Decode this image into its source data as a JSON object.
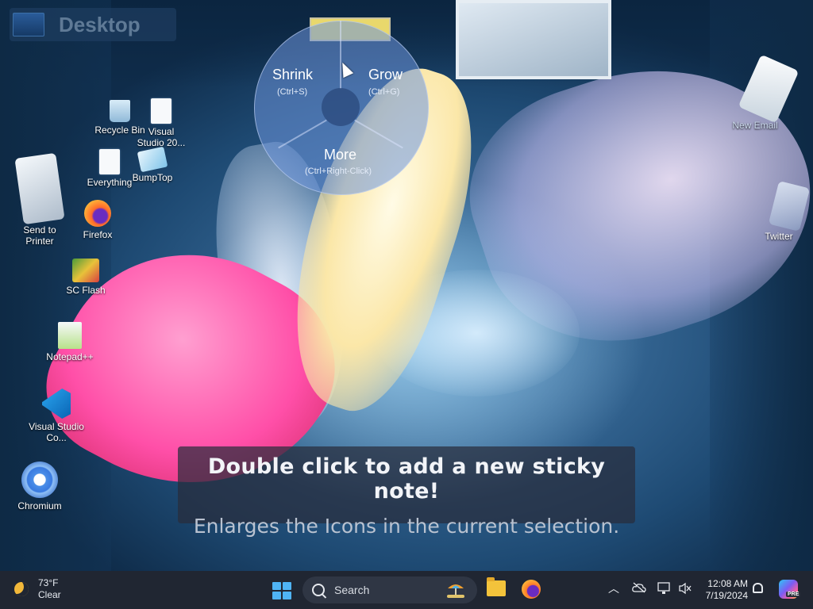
{
  "desktop": {
    "title": "Desktop",
    "pie_menu": {
      "shrink_label": "Shrink",
      "shrink_shortcut": "(Ctrl+S)",
      "grow_label": "Grow",
      "grow_shortcut": "(Ctrl+G)",
      "more_label": "More",
      "more_shortcut": "(Ctrl+Right-Click)"
    },
    "icons": {
      "recycle_bin": "Recycle Bin",
      "visual_studio_20": "Visual Studio 20...",
      "everything": "Everything",
      "bumptop": "BumpTop",
      "firefox": "Firefox",
      "send_to_printer": "Send to Printer",
      "sc_flash": "SC Flash",
      "notepadpp": "Notepad++",
      "visual_studio_code": "Visual Studio Co...",
      "chromium": "Chromium",
      "new_email": "New Email",
      "twitter": "Twitter"
    },
    "tooltip": {
      "line1": "Double click to add a new sticky note!",
      "line2": "Enlarges the Icons in the current selection."
    }
  },
  "taskbar": {
    "weather_temp": "73°F",
    "weather_condition": "Clear",
    "search_placeholder": "Search",
    "time": "12:08 AM",
    "date": "7/19/2024",
    "copilot_badge": "PRE",
    "accent_color": "#4fb4f5"
  }
}
